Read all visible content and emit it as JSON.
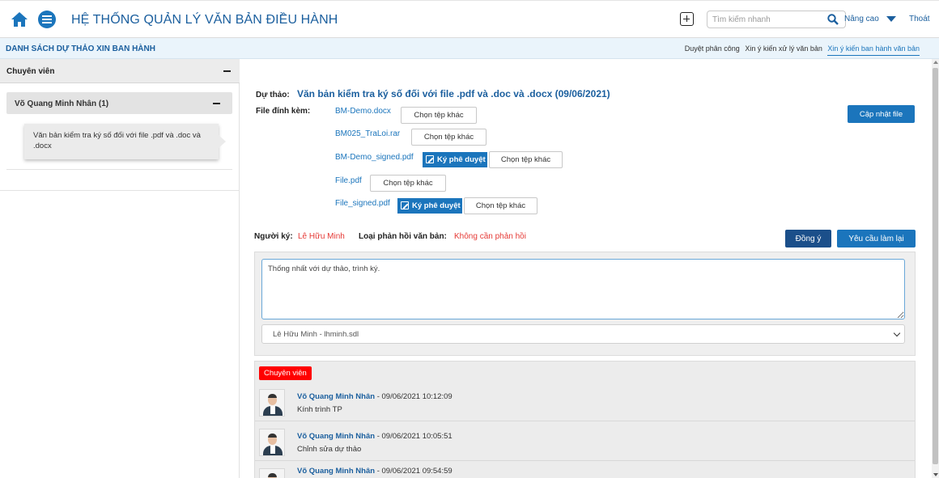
{
  "header": {
    "app_title": "HỆ THỐNG QUẢN LÝ VĂN BẢN ĐIỀU HÀNH",
    "search_placeholder": "Tìm kiếm nhanh",
    "advanced_label": "Nâng cao",
    "logout_label": "Thoát"
  },
  "subheader": {
    "page_title": "DANH SÁCH DỰ THẢO XIN BAN HÀNH",
    "tabs": [
      {
        "label": "Duyệt phân công",
        "active": false
      },
      {
        "label": "Xin ý kiến xử lý văn bản",
        "active": false
      },
      {
        "label": "Xin ý kiến ban hành văn bản",
        "active": true
      }
    ]
  },
  "sidebar": {
    "group_label": "Chuyên viên",
    "user_label": "Võ Quang Minh Nhân (1)",
    "document_title": "Văn bản kiểm tra ký số đối với file .pdf và .doc và .docx"
  },
  "draft": {
    "label": "Dự thảo:",
    "title": "Văn bản kiểm tra ký số đối với file .pdf và .doc và .docx (09/06/2021)",
    "attachments_label": "File đính kèm:",
    "update_button": "Cập nhật file",
    "choose_label": "Chọn tệp khác",
    "sign_label": "Ký phê duyệt",
    "files": [
      {
        "name": "BM-Demo.docx",
        "signable": false
      },
      {
        "name": "BM025_TraLoi.rar",
        "signable": false
      },
      {
        "name": "BM-Demo_signed.pdf",
        "signable": true
      },
      {
        "name": "File.pdf",
        "signable": false
      },
      {
        "name": "File_signed.pdf",
        "signable": true
      }
    ]
  },
  "signing": {
    "signer_label": "Người ký:",
    "signer_name": "Lê Hữu Minh",
    "reply_type_label": "Loại phản hồi văn bản:",
    "reply_type_value": "Không cần phản hồi",
    "agree_button": "Đồng ý",
    "redo_button": "Yêu cầu làm lại",
    "comment_value": "Thống nhất với dự thảo, trình ký.",
    "selected_signer": "Lê Hữu Minh - lhminh.sdl"
  },
  "history": {
    "role_badge": "Chuyên viên",
    "entries": [
      {
        "author": "Võ Quang Minh Nhân",
        "time": " - 09/06/2021 10:12:09",
        "content": "Kính trình TP"
      },
      {
        "author": "Võ Quang Minh Nhân",
        "time": " - 09/06/2021 10:05:51",
        "content": "Chỉnh sửa dự thảo"
      },
      {
        "author": "Võ Quang Minh Nhân",
        "time": " - 09/06/2021 09:54:59",
        "content": ""
      }
    ]
  },
  "colors": {
    "primary": "#1b75bc",
    "dark_primary": "#1b4f8a",
    "alert": "#e53935",
    "badge": "#ff0000"
  }
}
